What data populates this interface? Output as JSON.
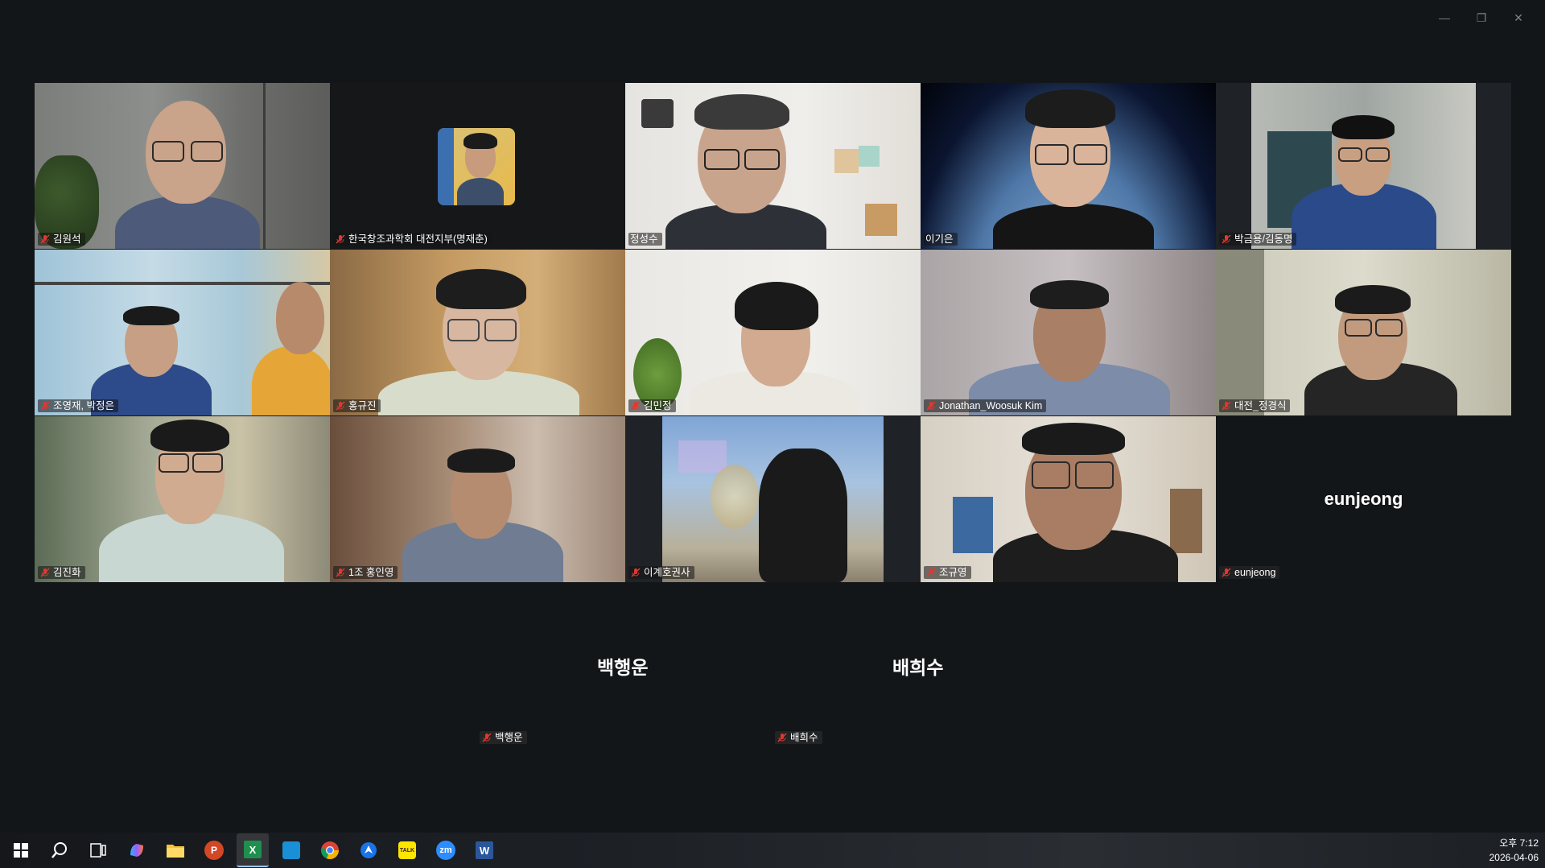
{
  "window": {
    "minimize": "—",
    "restore": "❐",
    "close": "✕"
  },
  "participants": [
    {
      "name": "김원석",
      "muted": true
    },
    {
      "name": "한국창조과학회 대전지부(명재춘)",
      "muted": true
    },
    {
      "name": "정성수",
      "muted": false
    },
    {
      "name": "이기은",
      "muted": false,
      "active_speaker": true
    },
    {
      "name": "박금용/김동명",
      "muted": true
    },
    {
      "name": "조영재, 박정은",
      "muted": true
    },
    {
      "name": "홍규진",
      "muted": true
    },
    {
      "name": "김민정",
      "muted": true
    },
    {
      "name": "Jonathan_Woosuk Kim",
      "muted": true
    },
    {
      "name": "대전_정경식",
      "muted": true
    },
    {
      "name": "김진화",
      "muted": true
    },
    {
      "name": "1조 홍인영",
      "muted": true
    },
    {
      "name": "이계호권사",
      "muted": true
    },
    {
      "name": "조규영",
      "muted": true
    },
    {
      "name": "eunjeong",
      "muted": true,
      "video_off": true,
      "display_name": "eunjeong"
    }
  ],
  "audio_only": [
    {
      "display_name": "백행운",
      "name": "백행운",
      "muted": true
    },
    {
      "display_name": "배희수",
      "name": "배희수",
      "muted": true
    }
  ],
  "taskbar": {
    "apps": [
      "windows-start-icon",
      "search-icon",
      "task-view-icon",
      "copilot-icon",
      "file-explorer-icon",
      "powerpoint-icon",
      "excel-icon",
      "store-icon",
      "chrome-icon",
      "pinned-app-icon",
      "kakaotalk-icon",
      "zoom-icon",
      "word-icon"
    ],
    "zoom_label": "zm",
    "word_label": "W",
    "excel_label": "X",
    "kakao_label": "TALK",
    "powerpoint_label": "P"
  },
  "clock": {
    "time": "오후 7:12",
    "date": "2026-04-06"
  },
  "colors": {
    "background": "#131619",
    "active_speaker": "#1dd37c",
    "muted": "#e0382f"
  }
}
